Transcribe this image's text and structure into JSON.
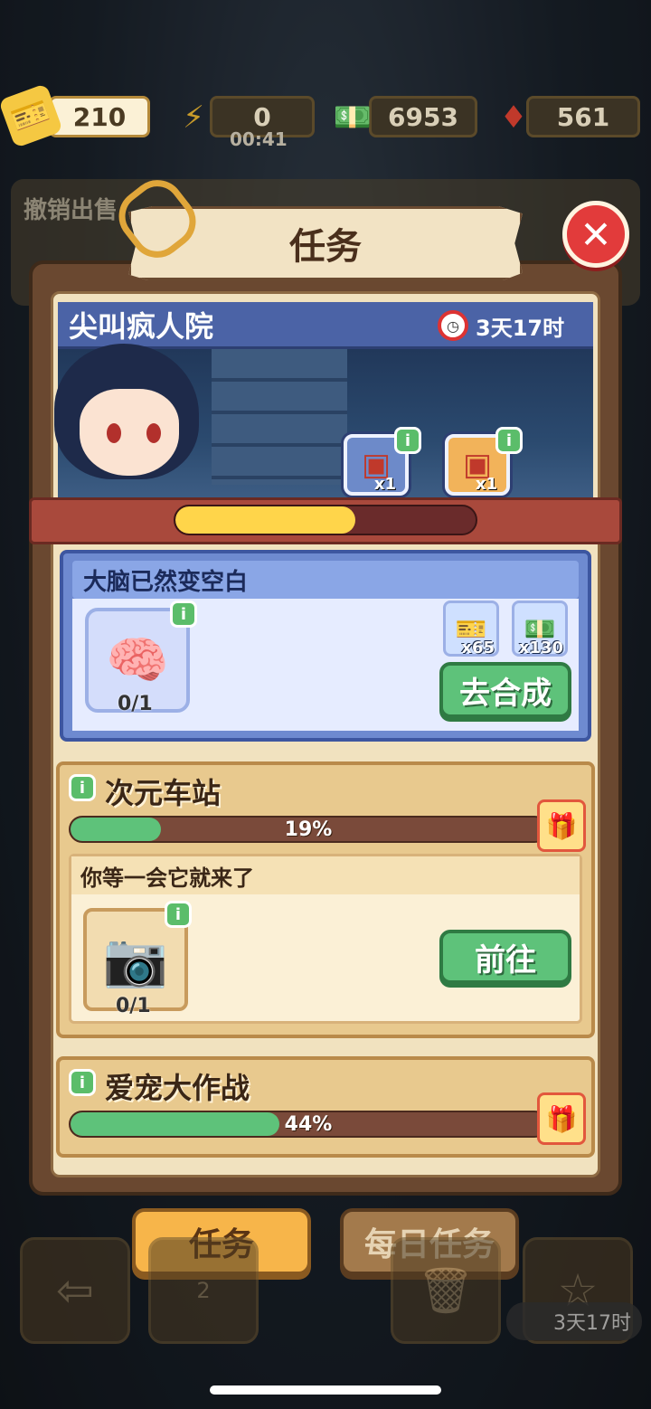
{
  "resources": {
    "tickets": "210",
    "energy": "0",
    "energy_timer": "00:41",
    "cash": "6953",
    "gems": "561"
  },
  "background": {
    "under_text": "撤销出售"
  },
  "dialog": {
    "title": "任务"
  },
  "event": {
    "name": "尖叫疯人院",
    "time_left": "3天17时",
    "progress": 0.6,
    "rewards": [
      {
        "icon": "red-chest-icon",
        "count": "x1"
      },
      {
        "icon": "gold-chest-icon",
        "count": "x1"
      }
    ]
  },
  "active_task": {
    "title": "大脑已然变空白",
    "item_icon": "brain-jar-icon",
    "item_progress": "0/1",
    "rewards": [
      {
        "icon": "ticket-icon",
        "count": "x65"
      },
      {
        "icon": "cash-icon",
        "count": "x130"
      }
    ],
    "button": "去合成"
  },
  "chapters": [
    {
      "title": "次元车站",
      "percent_label": "19%",
      "percent": 19,
      "subtask": {
        "title": "你等一会它就来了",
        "item_icon": "camera-icon",
        "item_progress": "0/1",
        "button": "前往"
      }
    },
    {
      "title": "爱宠大作战",
      "percent_label": "44%",
      "percent": 44
    }
  ],
  "tabs": {
    "tasks": "任务",
    "daily": "每日任务"
  },
  "dock": {
    "trophy_level": "2",
    "timer": "3天17时"
  },
  "info_badge": "i",
  "colors": {
    "accent_orange": "#f7b54a",
    "event_blue": "#4b63a6",
    "progress_yellow": "#ffd54a",
    "progress_green": "#5ec27a",
    "close_red": "#e23b3b"
  }
}
